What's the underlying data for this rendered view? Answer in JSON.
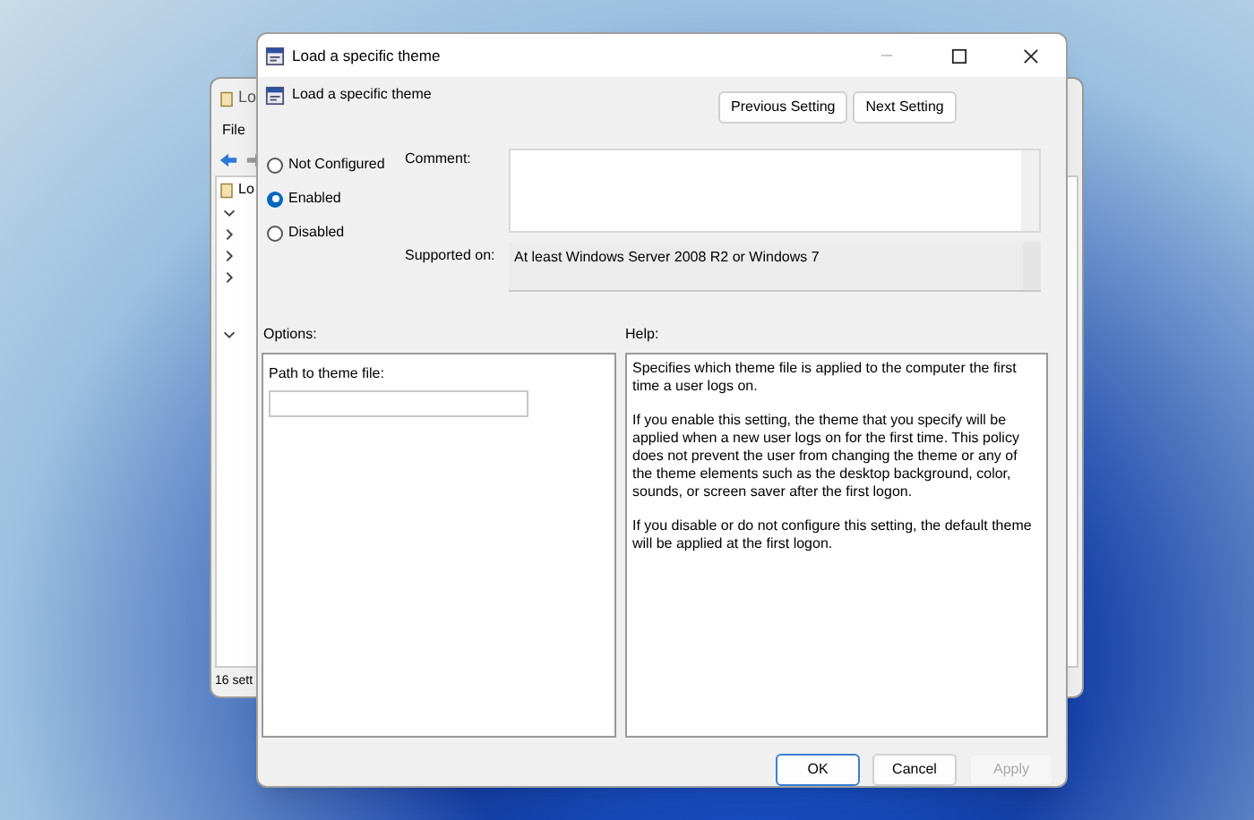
{
  "background_window": {
    "title": "Lo",
    "menu": [
      "File"
    ],
    "tree": [
      {
        "label": "Lo",
        "expanded": true
      }
    ],
    "status_bar": "16 sett"
  },
  "dialog": {
    "title": "Load a specific theme",
    "setting_name": "Load a specific theme",
    "nav_buttons": [
      {
        "label": "Previous Setting"
      },
      {
        "label": "Next Setting"
      }
    ],
    "states": [
      {
        "label": "Not Configured",
        "selected": false
      },
      {
        "label": "Enabled",
        "selected": true
      },
      {
        "label": "Disabled",
        "selected": false
      }
    ],
    "comment": {
      "label": "Comment:"
    },
    "supported_on": {
      "label": "Supported on:",
      "value": "At least Windows Server 2008 R2 or Windows 7"
    },
    "options": {
      "label": "Options:",
      "fields": [
        {
          "label": "Path to theme file:"
        }
      ]
    },
    "help": {
      "label": "Help:",
      "paragraphs": [
        "Specifies which theme file is applied to the computer the first time a user logs on.",
        "If you enable this setting, the theme that you specify will be applied when a new user logs on for the first time.  This policy does not prevent the user from changing the theme or any of the theme elements such as the desktop background, color, sounds, or screen saver after the first logon.",
        "If you disable or do not configure this setting, the default theme will be applied at the first logon."
      ]
    },
    "buttons": [
      {
        "label": "OK",
        "default": true,
        "disabled": false
      },
      {
        "label": "Cancel",
        "default": false,
        "disabled": false
      },
      {
        "label": "Apply",
        "default": false,
        "disabled": true
      }
    ]
  }
}
